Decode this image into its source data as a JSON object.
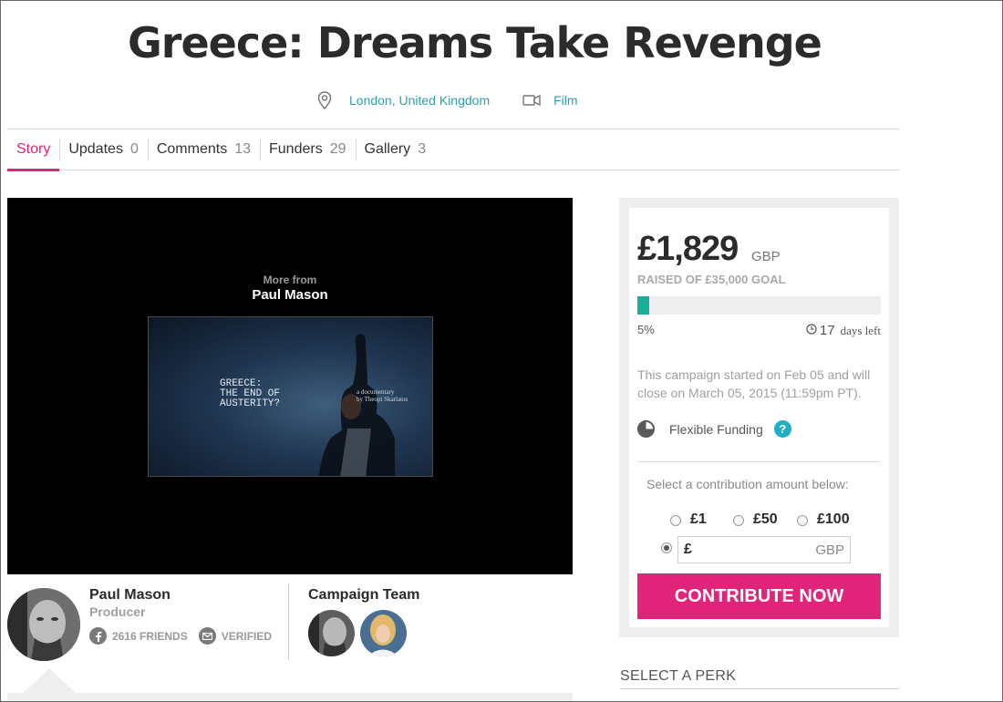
{
  "title": "Greece: Dreams Take Revenge",
  "meta": {
    "location_icon": "map-pin-icon",
    "location": "London, United Kingdom",
    "category_icon": "video-camera-icon",
    "category": "Film",
    "link_color": "#2a9fb0"
  },
  "tabs": [
    {
      "label": "Story",
      "count": ""
    },
    {
      "label": "Updates",
      "count": "0"
    },
    {
      "label": "Comments",
      "count": "13"
    },
    {
      "label": "Funders",
      "count": "29"
    },
    {
      "label": "Gallery",
      "count": "3"
    }
  ],
  "active_tab": "Story",
  "video": {
    "more_from": "More from",
    "channel": "Paul Mason",
    "thumb_title_lines": [
      "GREECE:",
      "THE END OF",
      "AUSTERITY?"
    ],
    "thumb_sub_lines": [
      "a documentary",
      "by Theopi Skarlatos"
    ]
  },
  "producer": {
    "name": "Paul Mason",
    "role": "Producer",
    "friends": "2616 FRIENDS",
    "friends_icon": "facebook-icon",
    "verified": "VERIFIED",
    "verified_icon": "mail-icon"
  },
  "team": {
    "title": "Campaign Team"
  },
  "funding": {
    "amount": "£1,829",
    "currency": "GBP",
    "raised_text": "RAISED OF £35,000 GOAL",
    "progress": 0.05,
    "percent": "5%",
    "days": "17",
    "days_left_label": "days left",
    "clock_icon": "clock-icon",
    "dates_text": "This campaign started on Feb 05 and will close on March 05, 2015 (11:59pm PT).",
    "funding_type": "Flexible Funding",
    "funding_icon": "pie-chart-icon",
    "help_icon": "question-icon",
    "select_label": "Select a contribution amount below:",
    "options": [
      "£1",
      "£50",
      "£100"
    ],
    "custom_symbol": "£",
    "custom_currency": "GBP",
    "selected": "custom",
    "button": "CONTRIBUTE NOW",
    "accent": "#e0247a",
    "progress_color": "#1aaf9d"
  },
  "perk_heading": "SELECT A PERK"
}
